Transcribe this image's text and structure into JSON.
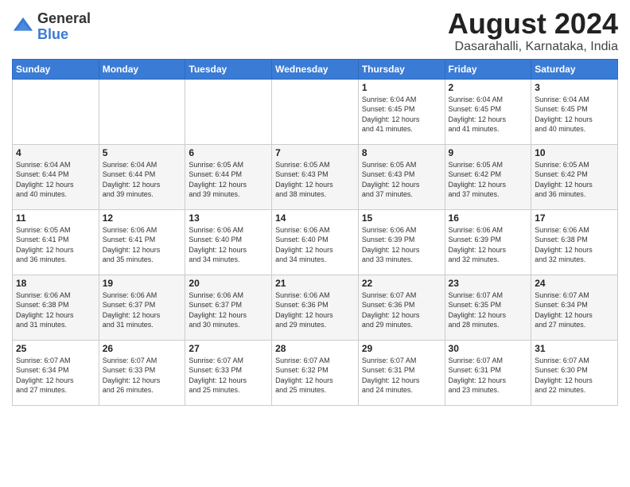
{
  "logo": {
    "line1": "General",
    "line2": "Blue"
  },
  "title": "August 2024",
  "subtitle": "Dasarahalli, Karnataka, India",
  "weekdays": [
    "Sunday",
    "Monday",
    "Tuesday",
    "Wednesday",
    "Thursday",
    "Friday",
    "Saturday"
  ],
  "weeks": [
    [
      {
        "day": "",
        "info": ""
      },
      {
        "day": "",
        "info": ""
      },
      {
        "day": "",
        "info": ""
      },
      {
        "day": "",
        "info": ""
      },
      {
        "day": "1",
        "info": "Sunrise: 6:04 AM\nSunset: 6:45 PM\nDaylight: 12 hours\nand 41 minutes."
      },
      {
        "day": "2",
        "info": "Sunrise: 6:04 AM\nSunset: 6:45 PM\nDaylight: 12 hours\nand 41 minutes."
      },
      {
        "day": "3",
        "info": "Sunrise: 6:04 AM\nSunset: 6:45 PM\nDaylight: 12 hours\nand 40 minutes."
      }
    ],
    [
      {
        "day": "4",
        "info": "Sunrise: 6:04 AM\nSunset: 6:44 PM\nDaylight: 12 hours\nand 40 minutes."
      },
      {
        "day": "5",
        "info": "Sunrise: 6:04 AM\nSunset: 6:44 PM\nDaylight: 12 hours\nand 39 minutes."
      },
      {
        "day": "6",
        "info": "Sunrise: 6:05 AM\nSunset: 6:44 PM\nDaylight: 12 hours\nand 39 minutes."
      },
      {
        "day": "7",
        "info": "Sunrise: 6:05 AM\nSunset: 6:43 PM\nDaylight: 12 hours\nand 38 minutes."
      },
      {
        "day": "8",
        "info": "Sunrise: 6:05 AM\nSunset: 6:43 PM\nDaylight: 12 hours\nand 37 minutes."
      },
      {
        "day": "9",
        "info": "Sunrise: 6:05 AM\nSunset: 6:42 PM\nDaylight: 12 hours\nand 37 minutes."
      },
      {
        "day": "10",
        "info": "Sunrise: 6:05 AM\nSunset: 6:42 PM\nDaylight: 12 hours\nand 36 minutes."
      }
    ],
    [
      {
        "day": "11",
        "info": "Sunrise: 6:05 AM\nSunset: 6:41 PM\nDaylight: 12 hours\nand 36 minutes."
      },
      {
        "day": "12",
        "info": "Sunrise: 6:06 AM\nSunset: 6:41 PM\nDaylight: 12 hours\nand 35 minutes."
      },
      {
        "day": "13",
        "info": "Sunrise: 6:06 AM\nSunset: 6:40 PM\nDaylight: 12 hours\nand 34 minutes."
      },
      {
        "day": "14",
        "info": "Sunrise: 6:06 AM\nSunset: 6:40 PM\nDaylight: 12 hours\nand 34 minutes."
      },
      {
        "day": "15",
        "info": "Sunrise: 6:06 AM\nSunset: 6:39 PM\nDaylight: 12 hours\nand 33 minutes."
      },
      {
        "day": "16",
        "info": "Sunrise: 6:06 AM\nSunset: 6:39 PM\nDaylight: 12 hours\nand 32 minutes."
      },
      {
        "day": "17",
        "info": "Sunrise: 6:06 AM\nSunset: 6:38 PM\nDaylight: 12 hours\nand 32 minutes."
      }
    ],
    [
      {
        "day": "18",
        "info": "Sunrise: 6:06 AM\nSunset: 6:38 PM\nDaylight: 12 hours\nand 31 minutes."
      },
      {
        "day": "19",
        "info": "Sunrise: 6:06 AM\nSunset: 6:37 PM\nDaylight: 12 hours\nand 31 minutes."
      },
      {
        "day": "20",
        "info": "Sunrise: 6:06 AM\nSunset: 6:37 PM\nDaylight: 12 hours\nand 30 minutes."
      },
      {
        "day": "21",
        "info": "Sunrise: 6:06 AM\nSunset: 6:36 PM\nDaylight: 12 hours\nand 29 minutes."
      },
      {
        "day": "22",
        "info": "Sunrise: 6:07 AM\nSunset: 6:36 PM\nDaylight: 12 hours\nand 29 minutes."
      },
      {
        "day": "23",
        "info": "Sunrise: 6:07 AM\nSunset: 6:35 PM\nDaylight: 12 hours\nand 28 minutes."
      },
      {
        "day": "24",
        "info": "Sunrise: 6:07 AM\nSunset: 6:34 PM\nDaylight: 12 hours\nand 27 minutes."
      }
    ],
    [
      {
        "day": "25",
        "info": "Sunrise: 6:07 AM\nSunset: 6:34 PM\nDaylight: 12 hours\nand 27 minutes."
      },
      {
        "day": "26",
        "info": "Sunrise: 6:07 AM\nSunset: 6:33 PM\nDaylight: 12 hours\nand 26 minutes."
      },
      {
        "day": "27",
        "info": "Sunrise: 6:07 AM\nSunset: 6:33 PM\nDaylight: 12 hours\nand 25 minutes."
      },
      {
        "day": "28",
        "info": "Sunrise: 6:07 AM\nSunset: 6:32 PM\nDaylight: 12 hours\nand 25 minutes."
      },
      {
        "day": "29",
        "info": "Sunrise: 6:07 AM\nSunset: 6:31 PM\nDaylight: 12 hours\nand 24 minutes."
      },
      {
        "day": "30",
        "info": "Sunrise: 6:07 AM\nSunset: 6:31 PM\nDaylight: 12 hours\nand 23 minutes."
      },
      {
        "day": "31",
        "info": "Sunrise: 6:07 AM\nSunset: 6:30 PM\nDaylight: 12 hours\nand 22 minutes."
      }
    ]
  ]
}
